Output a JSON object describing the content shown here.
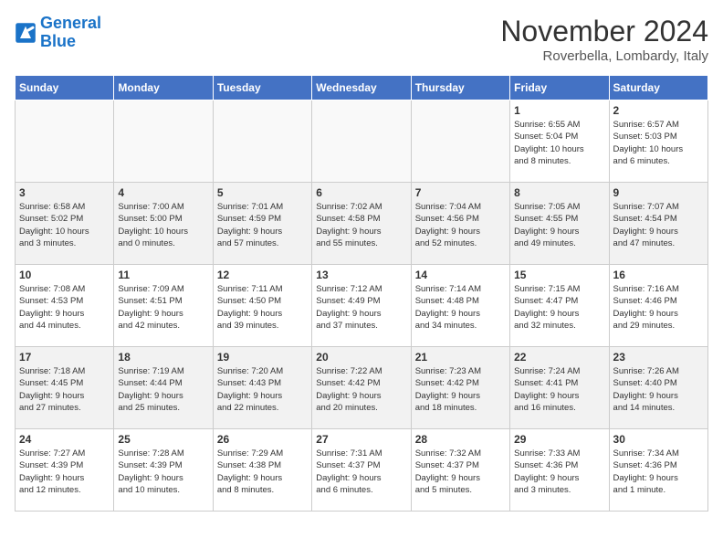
{
  "header": {
    "logo_line1": "General",
    "logo_line2": "Blue",
    "month_title": "November 2024",
    "location": "Roverbella, Lombardy, Italy"
  },
  "days_of_week": [
    "Sunday",
    "Monday",
    "Tuesday",
    "Wednesday",
    "Thursday",
    "Friday",
    "Saturday"
  ],
  "weeks": [
    [
      {
        "day": "",
        "text": ""
      },
      {
        "day": "",
        "text": ""
      },
      {
        "day": "",
        "text": ""
      },
      {
        "day": "",
        "text": ""
      },
      {
        "day": "",
        "text": ""
      },
      {
        "day": "1",
        "text": "Sunrise: 6:55 AM\nSunset: 5:04 PM\nDaylight: 10 hours\nand 8 minutes."
      },
      {
        "day": "2",
        "text": "Sunrise: 6:57 AM\nSunset: 5:03 PM\nDaylight: 10 hours\nand 6 minutes."
      }
    ],
    [
      {
        "day": "3",
        "text": "Sunrise: 6:58 AM\nSunset: 5:02 PM\nDaylight: 10 hours\nand 3 minutes."
      },
      {
        "day": "4",
        "text": "Sunrise: 7:00 AM\nSunset: 5:00 PM\nDaylight: 10 hours\nand 0 minutes."
      },
      {
        "day": "5",
        "text": "Sunrise: 7:01 AM\nSunset: 4:59 PM\nDaylight: 9 hours\nand 57 minutes."
      },
      {
        "day": "6",
        "text": "Sunrise: 7:02 AM\nSunset: 4:58 PM\nDaylight: 9 hours\nand 55 minutes."
      },
      {
        "day": "7",
        "text": "Sunrise: 7:04 AM\nSunset: 4:56 PM\nDaylight: 9 hours\nand 52 minutes."
      },
      {
        "day": "8",
        "text": "Sunrise: 7:05 AM\nSunset: 4:55 PM\nDaylight: 9 hours\nand 49 minutes."
      },
      {
        "day": "9",
        "text": "Sunrise: 7:07 AM\nSunset: 4:54 PM\nDaylight: 9 hours\nand 47 minutes."
      }
    ],
    [
      {
        "day": "10",
        "text": "Sunrise: 7:08 AM\nSunset: 4:53 PM\nDaylight: 9 hours\nand 44 minutes."
      },
      {
        "day": "11",
        "text": "Sunrise: 7:09 AM\nSunset: 4:51 PM\nDaylight: 9 hours\nand 42 minutes."
      },
      {
        "day": "12",
        "text": "Sunrise: 7:11 AM\nSunset: 4:50 PM\nDaylight: 9 hours\nand 39 minutes."
      },
      {
        "day": "13",
        "text": "Sunrise: 7:12 AM\nSunset: 4:49 PM\nDaylight: 9 hours\nand 37 minutes."
      },
      {
        "day": "14",
        "text": "Sunrise: 7:14 AM\nSunset: 4:48 PM\nDaylight: 9 hours\nand 34 minutes."
      },
      {
        "day": "15",
        "text": "Sunrise: 7:15 AM\nSunset: 4:47 PM\nDaylight: 9 hours\nand 32 minutes."
      },
      {
        "day": "16",
        "text": "Sunrise: 7:16 AM\nSunset: 4:46 PM\nDaylight: 9 hours\nand 29 minutes."
      }
    ],
    [
      {
        "day": "17",
        "text": "Sunrise: 7:18 AM\nSunset: 4:45 PM\nDaylight: 9 hours\nand 27 minutes."
      },
      {
        "day": "18",
        "text": "Sunrise: 7:19 AM\nSunset: 4:44 PM\nDaylight: 9 hours\nand 25 minutes."
      },
      {
        "day": "19",
        "text": "Sunrise: 7:20 AM\nSunset: 4:43 PM\nDaylight: 9 hours\nand 22 minutes."
      },
      {
        "day": "20",
        "text": "Sunrise: 7:22 AM\nSunset: 4:42 PM\nDaylight: 9 hours\nand 20 minutes."
      },
      {
        "day": "21",
        "text": "Sunrise: 7:23 AM\nSunset: 4:42 PM\nDaylight: 9 hours\nand 18 minutes."
      },
      {
        "day": "22",
        "text": "Sunrise: 7:24 AM\nSunset: 4:41 PM\nDaylight: 9 hours\nand 16 minutes."
      },
      {
        "day": "23",
        "text": "Sunrise: 7:26 AM\nSunset: 4:40 PM\nDaylight: 9 hours\nand 14 minutes."
      }
    ],
    [
      {
        "day": "24",
        "text": "Sunrise: 7:27 AM\nSunset: 4:39 PM\nDaylight: 9 hours\nand 12 minutes."
      },
      {
        "day": "25",
        "text": "Sunrise: 7:28 AM\nSunset: 4:39 PM\nDaylight: 9 hours\nand 10 minutes."
      },
      {
        "day": "26",
        "text": "Sunrise: 7:29 AM\nSunset: 4:38 PM\nDaylight: 9 hours\nand 8 minutes."
      },
      {
        "day": "27",
        "text": "Sunrise: 7:31 AM\nSunset: 4:37 PM\nDaylight: 9 hours\nand 6 minutes."
      },
      {
        "day": "28",
        "text": "Sunrise: 7:32 AM\nSunset: 4:37 PM\nDaylight: 9 hours\nand 5 minutes."
      },
      {
        "day": "29",
        "text": "Sunrise: 7:33 AM\nSunset: 4:36 PM\nDaylight: 9 hours\nand 3 minutes."
      },
      {
        "day": "30",
        "text": "Sunrise: 7:34 AM\nSunset: 4:36 PM\nDaylight: 9 hours\nand 1 minute."
      }
    ]
  ]
}
